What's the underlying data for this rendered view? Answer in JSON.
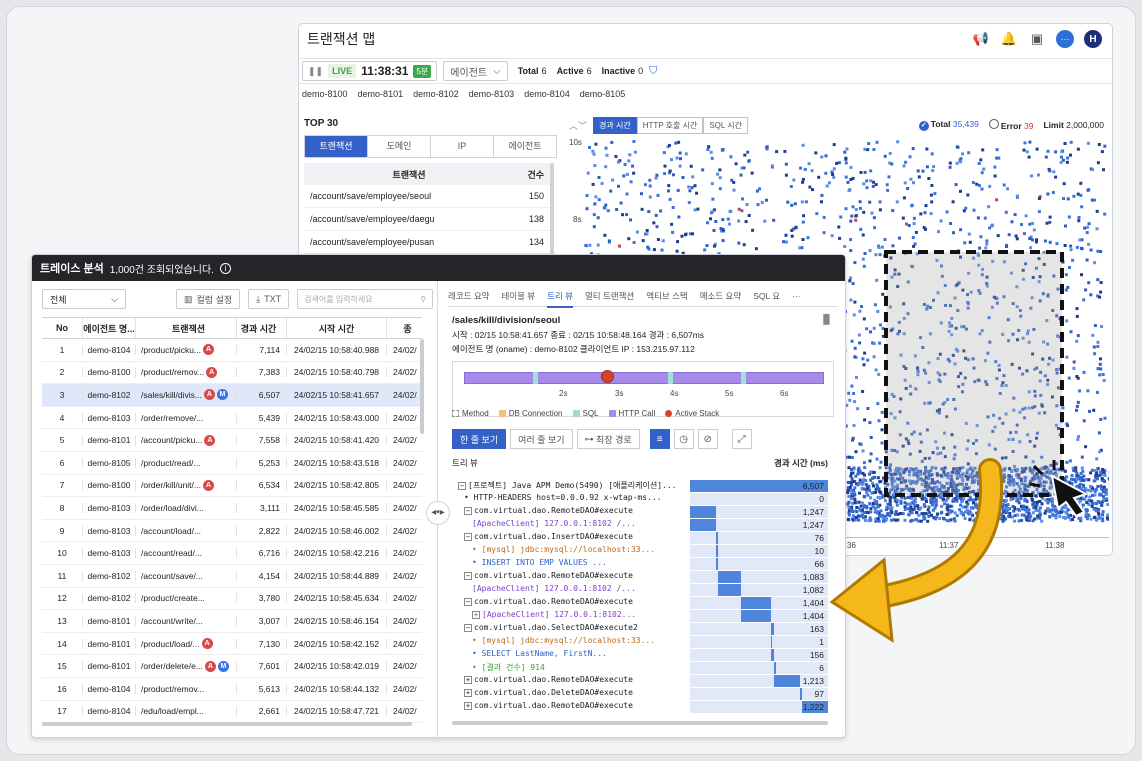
{
  "back_window": {
    "title": "트랜잭션 맵",
    "live": "LIVE",
    "time": "11:38:31",
    "min_badge": "5분",
    "agent_select": "에이전트",
    "total_label": "Total",
    "total_val": "6",
    "active_label": "Active",
    "active_val": "6",
    "inactive_label": "Inactive",
    "inactive_val": "0",
    "agents": [
      "demo-8100",
      "demo-8101",
      "demo-8102",
      "demo-8103",
      "demo-8104",
      "demo-8105"
    ],
    "top30": "TOP 30",
    "tabs": [
      "트랜잭션",
      "도메인",
      "IP",
      "에이전트"
    ],
    "col_tx": "트랜잭션",
    "col_cnt": "건수",
    "rows": [
      {
        "tx": "/account/save/employee/seoul",
        "cnt": "150"
      },
      {
        "tx": "/account/save/employee/daegu",
        "cnt": "138"
      },
      {
        "tx": "/account/save/employee/pusan",
        "cnt": "134"
      }
    ],
    "chart_tabs": [
      "경과 시간",
      "HTTP 호출 시간",
      "SQL 시간"
    ],
    "total_count_label": "Total",
    "total_count": "35,439",
    "error_label": "Error",
    "error_count": "39",
    "limit_label": "Limit",
    "limit_val": "2,000,000",
    "y_ticks": [
      "10s",
      "8s"
    ],
    "x_ticks": [
      "36",
      "11:37",
      "11:38"
    ]
  },
  "trace": {
    "title": "트레이스 분석",
    "count_msg": "1,000건 조회되었습니다.",
    "filter": "전체",
    "col_setting": "컬럼 설정",
    "txt_btn": "TXT",
    "search_placeholder": "검색어를 입력하세요",
    "headers": [
      "No",
      "에이전트 명...",
      "트랜잭션",
      "경과 시간",
      "시작 시간",
      "종"
    ],
    "rows": [
      {
        "no": "1",
        "agent": "demo-8104",
        "tx": "/product/picku...",
        "badges": [
          "A"
        ],
        "elapsed": "7,114",
        "start": "24/02/15 10:58:40.988",
        "end": "24/02/"
      },
      {
        "no": "2",
        "agent": "demo-8100",
        "tx": "/product/remov...",
        "badges": [
          "A"
        ],
        "elapsed": "7,383",
        "start": "24/02/15 10:58:40.798",
        "end": "24/02/"
      },
      {
        "no": "3",
        "agent": "demo-8102",
        "tx": "/sales/kill/divis...",
        "badges": [
          "A",
          "M"
        ],
        "elapsed": "6,507",
        "start": "24/02/15 10:58:41.657",
        "end": "24/02/"
      },
      {
        "no": "4",
        "agent": "demo-8103",
        "tx": "/order/remove/...",
        "badges": [],
        "elapsed": "5,439",
        "start": "24/02/15 10:58:43.000",
        "end": "24/02/"
      },
      {
        "no": "5",
        "agent": "demo-8101",
        "tx": "/account/picku...",
        "badges": [
          "A"
        ],
        "elapsed": "7,558",
        "start": "24/02/15 10:58:41.420",
        "end": "24/02/"
      },
      {
        "no": "6",
        "agent": "demo-8105",
        "tx": "/product/read/...",
        "badges": [],
        "elapsed": "5,253",
        "start": "24/02/15 10:58:43.518",
        "end": "24/02/"
      },
      {
        "no": "7",
        "agent": "demo-8100",
        "tx": "/order/kill/unit/...",
        "badges": [
          "A"
        ],
        "elapsed": "6,534",
        "start": "24/02/15 10:58:42.805",
        "end": "24/02/"
      },
      {
        "no": "8",
        "agent": "demo-8103",
        "tx": "/order/load/divi...",
        "badges": [],
        "elapsed": "3,111",
        "start": "24/02/15 10:58:45.585",
        "end": "24/02/"
      },
      {
        "no": "9",
        "agent": "demo-8103",
        "tx": "/account/load/...",
        "badges": [],
        "elapsed": "2,822",
        "start": "24/02/15 10:58:46.002",
        "end": "24/02/"
      },
      {
        "no": "10",
        "agent": "demo-8103",
        "tx": "/account/read/...",
        "badges": [],
        "elapsed": "6,716",
        "start": "24/02/15 10:58:42.216",
        "end": "24/02/"
      },
      {
        "no": "11",
        "agent": "demo-8102",
        "tx": "/account/save/...",
        "badges": [],
        "elapsed": "4,154",
        "start": "24/02/15 10:58:44.889",
        "end": "24/02/"
      },
      {
        "no": "12",
        "agent": "demo-8102",
        "tx": "/product/create...",
        "badges": [],
        "elapsed": "3,780",
        "start": "24/02/15 10:58:45.634",
        "end": "24/02/"
      },
      {
        "no": "13",
        "agent": "demo-8101",
        "tx": "/account/write/...",
        "badges": [],
        "elapsed": "3,007",
        "start": "24/02/15 10:58:46.154",
        "end": "24/02/"
      },
      {
        "no": "14",
        "agent": "demo-8101",
        "tx": "/product/load/...",
        "badges": [
          "A"
        ],
        "elapsed": "7,130",
        "start": "24/02/15 10:58:42.152",
        "end": "24/02/"
      },
      {
        "no": "15",
        "agent": "demo-8101",
        "tx": "/order/delete/e...",
        "badges": [
          "A",
          "M"
        ],
        "elapsed": "7,601",
        "start": "24/02/15 10:58:42.019",
        "end": "24/02/"
      },
      {
        "no": "16",
        "agent": "demo-8104",
        "tx": "/product/remov...",
        "badges": [],
        "elapsed": "5,613",
        "start": "24/02/15 10:58:44.132",
        "end": "24/02/"
      },
      {
        "no": "17",
        "agent": "demo-8104",
        "tx": "/edu/load/empl...",
        "badges": [],
        "elapsed": "2,661",
        "start": "24/02/15 10:58:47.721",
        "end": "24/02/"
      }
    ],
    "detail_tabs": [
      "레코드 요약",
      "테이블 뷰",
      "트리 뷰",
      "멀티 트랜잭션",
      "액티브 스택",
      "메소드 요약",
      "SQL 요",
      "···"
    ],
    "url": "/sales/kill/division/seoul",
    "meta1": "시작 : 02/15 10:58:41.657    종료 : 02/15 10:58:48.164    경과 : 6,507ms",
    "meta2": "에이전트 명 (oname) : demo-8102    클라이언트 IP : 153.215.97.112",
    "timeline_ticks": [
      "2s",
      "3s",
      "4s",
      "5s",
      "6s"
    ],
    "legend": [
      "Method",
      "DB Connection",
      "SQL",
      "HTTP Call",
      "Active Stack"
    ],
    "view_one": "한 줄 보기",
    "view_multi": "여러 줄 보기",
    "longest_path": "최장 경로",
    "tree_label": "트리 뷰",
    "elapsed_col": "경과 시간 (ms)",
    "tree": [
      {
        "text": "[프로젝트] Java APM Demo(5490) [애플리케이션]...",
        "val": "6,507",
        "ratio": 1.0,
        "offset": 0,
        "cls": "",
        "lvl": 0,
        "exp": "−"
      },
      {
        "text": "• HTTP-HEADERS host=0.0.0.92 x-wtap-ms...",
        "val": "0",
        "ratio": 0,
        "offset": 0,
        "cls": "",
        "lvl": 1,
        "exp": ""
      },
      {
        "text": "com.virtual.dao.RemoteDAO#execute",
        "val": "1,247",
        "ratio": 0.19,
        "offset": 0,
        "cls": "",
        "lvl": 1,
        "exp": "−"
      },
      {
        "text": "[ApacheClient] 127.0.0.1:8102 /...",
        "val": "1,247",
        "ratio": 0.19,
        "offset": 0,
        "cls": "purple",
        "lvl": 2,
        "exp": ""
      },
      {
        "text": "com.virtual.dao.InsertDAO#execute",
        "val": "76",
        "ratio": 0.012,
        "offset": 0.19,
        "cls": "",
        "lvl": 1,
        "exp": "−"
      },
      {
        "text": "• [mysql] jdbc:mysql://localhost:33...",
        "val": "10",
        "ratio": 0.004,
        "offset": 0.19,
        "cls": "orange",
        "lvl": 2,
        "exp": ""
      },
      {
        "text": "• INSERT INTO EMP VALUES ...",
        "val": "66",
        "ratio": 0.01,
        "offset": 0.192,
        "cls": "kw",
        "lvl": 2,
        "exp": ""
      },
      {
        "text": "com.virtual.dao.RemoteDAO#execute",
        "val": "1,083",
        "ratio": 0.166,
        "offset": 0.202,
        "cls": "",
        "lvl": 1,
        "exp": "−"
      },
      {
        "text": "[ApacheClient] 127.0.0.1:8102 /...",
        "val": "1,082",
        "ratio": 0.166,
        "offset": 0.202,
        "cls": "purple",
        "lvl": 2,
        "exp": ""
      },
      {
        "text": "com.virtual.dao.RemoteDAO#execute",
        "val": "1,404",
        "ratio": 0.216,
        "offset": 0.368,
        "cls": "",
        "lvl": 1,
        "exp": "−"
      },
      {
        "text": "[ApacheClient] 127.0.0.1:8102...",
        "val": "1,404",
        "ratio": 0.216,
        "offset": 0.368,
        "cls": "purple",
        "lvl": 2,
        "exp": "+"
      },
      {
        "text": "com.virtual.dao.SelectDAO#execute2",
        "val": "163",
        "ratio": 0.025,
        "offset": 0.584,
        "cls": "",
        "lvl": 1,
        "exp": "−"
      },
      {
        "text": "• [mysql] jdbc:mysql://localhost:33...",
        "val": "1",
        "ratio": 0.003,
        "offset": 0.584,
        "cls": "orange",
        "lvl": 2,
        "exp": ""
      },
      {
        "text": "• SELECT LastName, FirstN...",
        "val": "156",
        "ratio": 0.024,
        "offset": 0.585,
        "cls": "kw",
        "lvl": 2,
        "exp": ""
      },
      {
        "text": "• [결과 건수] 914",
        "val": "6",
        "ratio": 0.003,
        "offset": 0.609,
        "cls": "green",
        "lvl": 2,
        "exp": ""
      },
      {
        "text": "com.virtual.dao.RemoteDAO#execute",
        "val": "1,213",
        "ratio": 0.186,
        "offset": 0.612,
        "cls": "",
        "lvl": 1,
        "exp": "+"
      },
      {
        "text": "com.virtual.dao.DeleteDAO#execute",
        "val": "97",
        "ratio": 0.015,
        "offset": 0.798,
        "cls": "",
        "lvl": 1,
        "exp": "+"
      },
      {
        "text": "com.virtual.dao.RemoteDAO#execute",
        "val": "1,222",
        "ratio": 0.188,
        "offset": 0.812,
        "cls": "",
        "lvl": 1,
        "exp": "+"
      }
    ]
  }
}
